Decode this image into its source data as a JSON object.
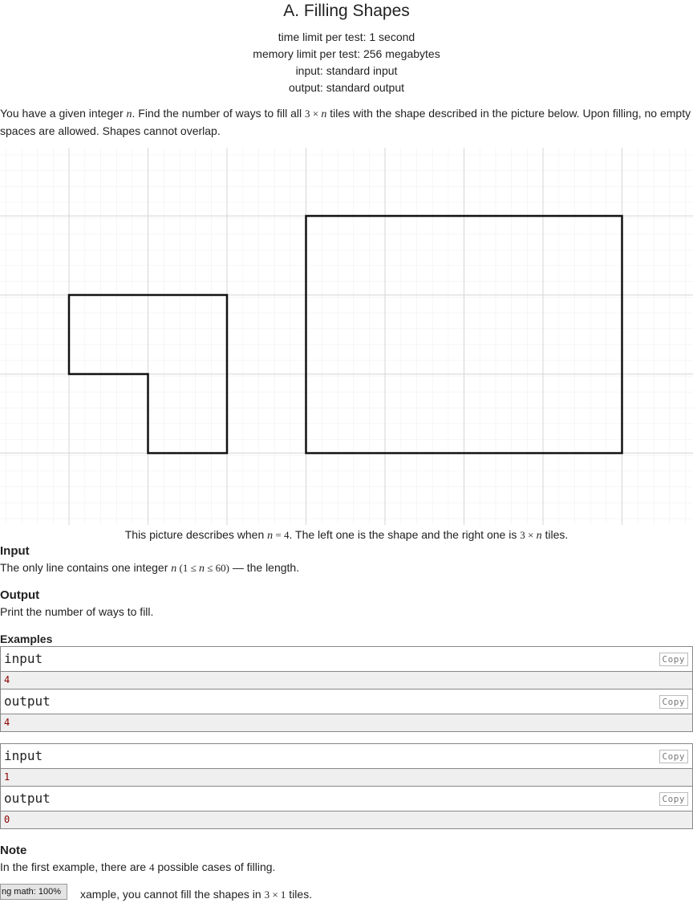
{
  "problem": {
    "title": "A. Filling Shapes",
    "time_limit": "time limit per test: 1 second",
    "memory_limit": "memory limit per test: 256 megabytes",
    "input_spec": "input: standard input",
    "output_spec": "output: standard output"
  },
  "statement": {
    "p1_a": "You have a given integer ",
    "var_n": "n",
    "p1_b": ". Find the number of ways to fill all ",
    "dims_3xn": "3 × ",
    "p1_c": " tiles with the shape described in the picture below. Upon filling, no empty spaces are allowed. Shapes cannot overlap."
  },
  "caption": {
    "a": "This picture describes when ",
    "eq": " = 4",
    "b": ". The left one is the shape and the right one is ",
    "dims": "3 × ",
    "c": " tiles."
  },
  "input_section": {
    "title": "Input",
    "text_a": "The only line contains one integer ",
    "constraint_open": " (1 ≤ ",
    "constraint_close": " ≤ 60)",
    "text_b": " — the length."
  },
  "output_section": {
    "title": "Output",
    "text": "Print the number of ways to fill."
  },
  "examples": {
    "title": "Examples",
    "input_label": "input",
    "output_label": "output",
    "copy_label": "Copy",
    "cases": [
      {
        "input": "4",
        "output": "4"
      },
      {
        "input": "1",
        "output": "0"
      }
    ]
  },
  "note": {
    "title": "Note",
    "line1_a": "In the first example, there are ",
    "line1_num": "4",
    "line1_b": " possible cases of filling.",
    "line2_visible": "xample, you cannot fill the shapes in ",
    "line2_dims": "3 × 1",
    "line2_end": " tiles."
  },
  "overlay": {
    "text": "ng math: 100%"
  }
}
